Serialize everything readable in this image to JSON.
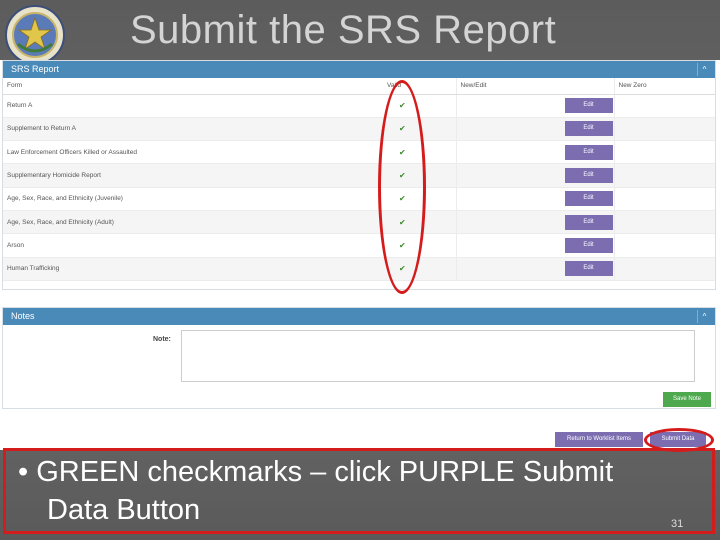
{
  "slide": {
    "title": "Submit the SRS Report",
    "bullet_mark": "•",
    "bullet_line1": "GREEN checkmarks – click PURPLE Submit",
    "bullet_line2": "Data Button",
    "page_number": "31"
  },
  "srs_panel": {
    "title": "SRS Report",
    "collapse": "^",
    "columns": [
      "Form",
      "Valid",
      "New/Edit",
      "New Zero"
    ],
    "rows": [
      {
        "form": "Return A",
        "valid": "✔",
        "action": "Edit"
      },
      {
        "form": "Supplement to Return A",
        "valid": "✔",
        "action": "Edit"
      },
      {
        "form": "Law Enforcement Officers Killed or Assaulted",
        "valid": "✔",
        "action": "Edit"
      },
      {
        "form": "Supplementary Homicide Report",
        "valid": "✔",
        "action": "Edit"
      },
      {
        "form": "Age, Sex, Race, and Ethnicity (Juvenile)",
        "valid": "✔",
        "action": "Edit"
      },
      {
        "form": "Age, Sex, Race, and Ethnicity (Adult)",
        "valid": "✔",
        "action": "Edit"
      },
      {
        "form": "Arson",
        "valid": "✔",
        "action": "Edit"
      },
      {
        "form": "Human Trafficking",
        "valid": "✔",
        "action": "Edit"
      }
    ]
  },
  "notes_panel": {
    "title": "Notes",
    "collapse": "^",
    "note_label": "Note:",
    "save_label": "Save Note"
  },
  "footer_buttons": {
    "return_label": "Return to Worklist Items",
    "submit_label": "Submit Data"
  },
  "colors": {
    "panel_header": "#4a8ab8",
    "purple_button": "#7b6db0",
    "green_button": "#4ea84e",
    "highlight_red": "#d41c1c",
    "check_green": "#3b8a2a"
  }
}
